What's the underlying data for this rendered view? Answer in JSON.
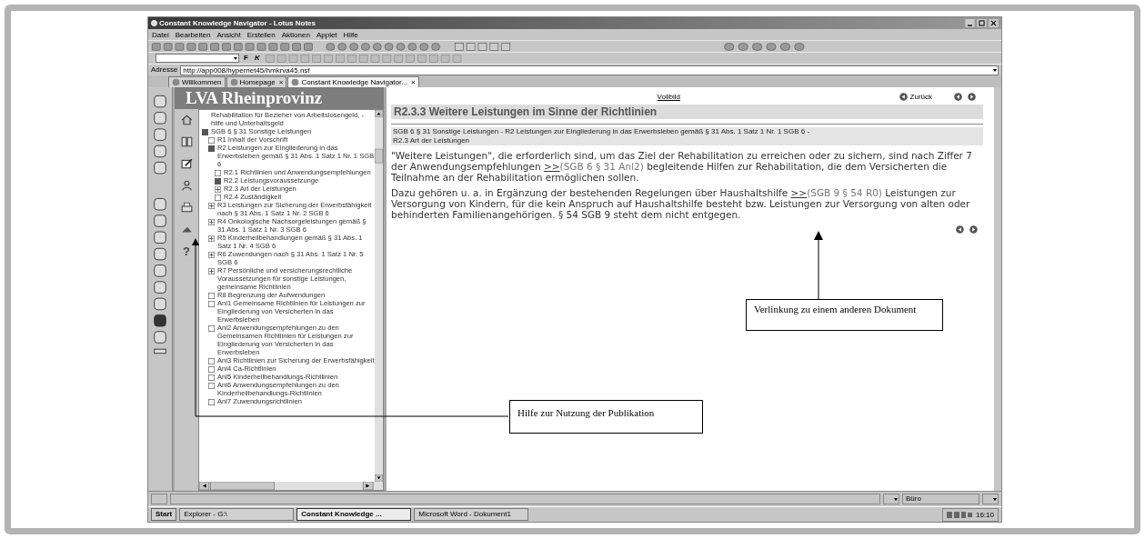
{
  "window": {
    "title": "Constant Knowledge Navigator - Lotus Notes"
  },
  "menu": [
    "Datei",
    "Bearbeiten",
    "Ansicht",
    "Erstellen",
    "Aktionen",
    "Applet",
    "Hilfe"
  ],
  "format_toolbar": {
    "bold": "F",
    "italic": "K"
  },
  "address": {
    "label": "Adresse",
    "value": "http://app008/hypernet45/hmkrva45.nsf"
  },
  "tabs": [
    {
      "label": "Willkommen",
      "selected": false
    },
    {
      "label": "Homepage",
      "close": "×",
      "selected": false
    },
    {
      "label": "Constant Knowledge Navigator...",
      "close": "×",
      "selected": true
    }
  ],
  "navigator": {
    "header": "LVA Rheinprovinz",
    "help_glyph": "?",
    "tree": [
      {
        "kind": "none",
        "label": "Rehabilitation für Bezieher von Arbeitslosengeld, - hilfe und Unterhaltsgeld"
      },
      {
        "kind": "filled",
        "label": "SGB 6 § 31 Sonstige Leistungen",
        "children": [
          {
            "kind": "empty",
            "label": "R1  Inhalt der Vorschrift"
          },
          {
            "kind": "filled",
            "label": "R2  Leistungen zur Eingliederung in das Erwerbsleben gemäß § 31 Abs. 1 Satz 1 Nr. 1 SGB 6",
            "children": [
              {
                "kind": "empty",
                "label": "R2.1  Richtlinien und Anwendungsempfehlungen"
              },
              {
                "kind": "filled",
                "label": "R2.2  Leistungsvoraussetzunge"
              },
              {
                "kind": "plus",
                "label": "R2.3  Art der Leistungen"
              },
              {
                "kind": "empty",
                "label": "R2.4  Zuständigkeit"
              }
            ]
          },
          {
            "kind": "plus",
            "label": "R3  Leistungen zur Sicherung der Erwerbsfähigkeit nach § 31 Abs. 1 Satz 1 Nr. 2 SGB 6"
          },
          {
            "kind": "plus",
            "label": "R4  Onkologische Nachsorgeleistungen gemäß § 31 Abs. 1 Satz 1 Nr. 3 SGB 6"
          },
          {
            "kind": "plus",
            "label": "R5  Kinderheilbehandlungen gemäß § 31 Abs. 1 Satz 1 Nr. 4 SGB 6"
          },
          {
            "kind": "plus",
            "label": "R6  Zuwendungen nach § 31 Abs. 1 Satz 1 Nr. 5 SGB 6"
          },
          {
            "kind": "plus",
            "label": "R7  Persönliche und versicherungsrechtliche Voraussetzungen für sonstige Leistungen, gemeinsame Richtlinien"
          },
          {
            "kind": "empty",
            "label": "R8  Begrenzung der Aufwendungen"
          },
          {
            "kind": "empty",
            "label": "Anl1  Gemeinsame Richtlinien für Leistungen zur Eingliederung von Versicherten in das Erwerbsleben"
          },
          {
            "kind": "empty",
            "label": "Anl2  Anwendungsempfehlungen zu den Gemeinsamen Richtlinien für Leistungen zur Eingliederung von Versicherten in das Erwerbsleben"
          },
          {
            "kind": "empty",
            "label": "Anl3  Richtlinien zur Sicherung der Erwerbsfähigkeit"
          },
          {
            "kind": "empty",
            "label": "Anl4  Ca-Richtlinien"
          },
          {
            "kind": "empty",
            "label": "Anl5  Kinderheilbehandlungs-Richtlinien"
          },
          {
            "kind": "empty",
            "label": "Anl6  Anwendungsempfehlungen zu den Kinderheilbehandlungs-Richtlinien"
          },
          {
            "kind": "empty",
            "label": "Anl7  Zuwendungsrichtlinien"
          }
        ]
      }
    ]
  },
  "document": {
    "fullscreen_link": "Vollbild",
    "back_link": "Zurück",
    "heading": "R2.3.3  Weitere Leistungen im Sinne der Richtlinien",
    "breadcrumb": [
      "SGB 6 § 31 Sonstige Leistungen - R2  Leistungen zur Eingliederung in das Erwerbsleben gemäß § 31 Abs. 1 Satz 1 Nr. 1 SGB 6 -",
      "R2.3  Art der Leistungen"
    ],
    "paragraphs": [
      {
        "before": "\"Weitere Leistungen\", die erforderlich sind, um das Ziel der Rehabilitation zu erreichen oder zu sichern, sind nach Ziffer 7 der Anwendungsempfehlungen ",
        "link_marker": ">>",
        "link_ref": "(SGB 6 § 31 Anl2)",
        "after": " begleitende Hilfen zur Rehabilitation, die dem Versicherten die Teilnahme an der Rehabilitation ermöglichen sollen."
      },
      {
        "before": "Dazu gehören u. a. in Ergänzung der bestehenden Regelungen über Haushaltshilfe ",
        "link_marker": ">>",
        "link_ref": "(SGB 9 § 54 R0)",
        "after": " Leistungen zur Versorgung von Kindern, für die kein Anspruch auf Haushaltshilfe besteht bzw. Leistungen zur Versorgung von alten oder behinderten Familienangehörigen. § 54 SGB 9 steht dem nicht entgegen."
      }
    ]
  },
  "status_bar": {
    "location": "Büro"
  },
  "taskbar": {
    "start": "Start",
    "buttons": [
      {
        "label": "Explorer - G:\\",
        "selected": false
      },
      {
        "label": "Constant Knowledge ...",
        "selected": true
      },
      {
        "label": "Microsoft Word - Dokument1",
        "selected": false
      }
    ],
    "clock": "16:10"
  },
  "callouts": [
    "Hilfe zur Nutzung der Publikation",
    "Verlinkung zu einem anderen Dokument"
  ]
}
